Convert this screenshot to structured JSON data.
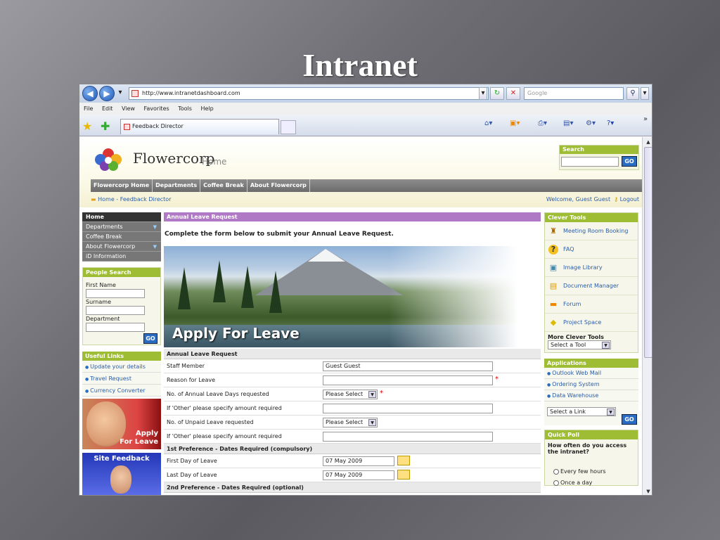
{
  "slide_title": "Intranet",
  "browser": {
    "url": "http://www.intranetdashboard.com",
    "search_placeholder": "Google",
    "menu": [
      "File",
      "Edit",
      "View",
      "Favorites",
      "Tools",
      "Help"
    ],
    "tab_title": "Feedback Director"
  },
  "site": {
    "brand": "Flowercorp",
    "brand_sub": "Home",
    "search_title": "Search",
    "go": "GO",
    "nav": [
      "Flowercorp Home",
      "Departments",
      "Coffee Break",
      "About Flowercorp"
    ],
    "breadcrumb": "Home - Feedback Director",
    "welcome": "Welcome, Guest Guest",
    "logout": "Logout"
  },
  "left": {
    "nav": [
      {
        "label": "Home"
      },
      {
        "label": "Departments",
        "dropdown": true
      },
      {
        "label": "Coffee Break"
      },
      {
        "label": "About Flowercorp",
        "dropdown": true
      },
      {
        "label": "iD Information"
      }
    ],
    "people_search": {
      "title": "People Search",
      "first_name": "First Name",
      "surname": "Surname",
      "department": "Department"
    },
    "useful_links": {
      "title": "Useful Links",
      "items": [
        "Update your details",
        "Travel Request",
        "Currency Converter"
      ]
    },
    "apply_banner": {
      "line1": "Apply",
      "line2": "For Leave"
    },
    "feedback_banner": "Site Feedback"
  },
  "main": {
    "title": "Annual Leave Request",
    "intro": "Complete the form below to submit your Annual Leave Request.",
    "hero_caption": "Apply For Leave",
    "form_title": "Annual Leave Request",
    "rows": [
      {
        "label": "Staff Member",
        "value": "Guest  Guest"
      },
      {
        "label": "Reason for Leave",
        "value": ""
      },
      {
        "label": "No. of Annual Leave Days requested",
        "value": "Please Select"
      },
      {
        "label": "If 'Other' please specify amount required",
        "value": ""
      },
      {
        "label": "No. of Unpaid Leave requested",
        "value": "Please Select"
      },
      {
        "label": "If 'Other' please specify amount required",
        "value": ""
      }
    ],
    "pref1_title": "1st Preference - Dates Required (compulsory)",
    "pref1": [
      {
        "label": "First Day of Leave",
        "value": "07 May 2009"
      },
      {
        "label": "Last Day of Leave",
        "value": "07 May 2009"
      }
    ],
    "pref2_title": "2nd Preference - Dates Required (optional)"
  },
  "right": {
    "tools_title": "Clever Tools",
    "tools": [
      {
        "label": "Meeting Room Booking",
        "icon": "meeting-room-icon"
      },
      {
        "label": "FAQ",
        "icon": "faq-icon"
      },
      {
        "label": "Image Library",
        "icon": "image-library-icon"
      },
      {
        "label": "Document Manager",
        "icon": "document-manager-icon"
      },
      {
        "label": "Forum",
        "icon": "forum-icon"
      },
      {
        "label": "Project Space",
        "icon": "project-space-icon"
      }
    ],
    "more_tools": "More Clever Tools",
    "select_tool": "Select a Tool",
    "apps_title": "Applications",
    "apps": [
      "Outlook Web Mail",
      "Ordering System",
      "Data Warehouse"
    ],
    "select_link": "Select a Link",
    "poll_title": "Quick Poll",
    "poll_question": "How often do you access the intranet?",
    "poll_options": [
      "Every few hours",
      "Once a day"
    ]
  },
  "colors": {
    "accent_green": "#9fbd34",
    "accent_purple": "#b079c6",
    "link_blue": "#2a5ca8"
  }
}
